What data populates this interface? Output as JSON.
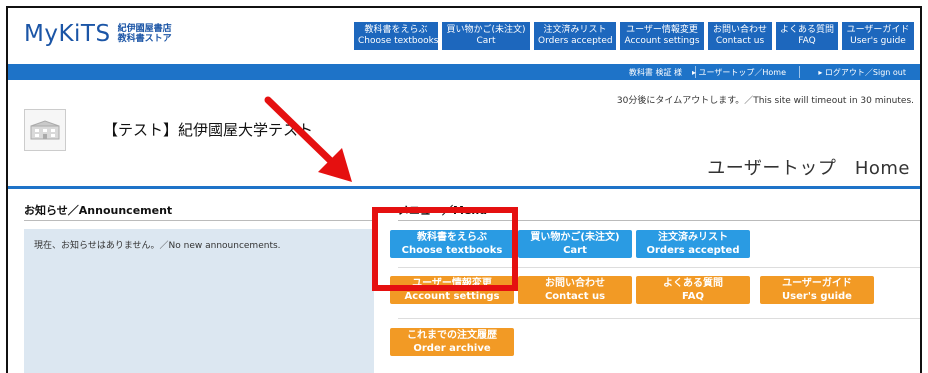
{
  "header": {
    "logo_text": "MyKiTS",
    "logo_sub_1": "紀伊國屋書店",
    "logo_sub_2": "教科書ストア"
  },
  "topnav": [
    {
      "jp": "教科書をえらぶ",
      "en": "Choose textbooks"
    },
    {
      "jp": "買い物かご(未注文)",
      "en": "Cart"
    },
    {
      "jp": "注文済みリスト",
      "en": "Orders accepted"
    },
    {
      "jp": "ユーザー情報変更",
      "en": "Account settings"
    },
    {
      "jp": "お問い合わせ",
      "en": "Contact us"
    },
    {
      "jp": "よくある質問",
      "en": "FAQ"
    },
    {
      "jp": "ユーザーガイド",
      "en": "User's guide"
    }
  ],
  "userbar": {
    "user_name": "教科書 検証 様",
    "home_link": "▸ ユーザートップ／Home",
    "logout_link": "▸ ログアウト／Sign out"
  },
  "timeout_notice": "30分後にタイムアウトします。／This site will timeout in 30 minutes.",
  "school_name": "【テスト】紀伊國屋大学テスト",
  "page_title": "ユーザートップ　Home",
  "announcements": {
    "heading": "お知らせ／Announcement",
    "text": "現在、お知らせはありません。／No new announcements."
  },
  "menu": {
    "heading": "メニュー／Menu",
    "buttons": [
      {
        "jp": "教科書をえらぶ",
        "en": "Choose textbooks",
        "color": "#2a9be3"
      },
      {
        "jp": "買い物かご(未注文)",
        "en": "Cart",
        "color": "#2a9be3"
      },
      {
        "jp": "注文済みリスト",
        "en": "Orders accepted",
        "color": "#2a9be3"
      },
      {
        "jp": "ユーザー情報変更",
        "en": "Account settings",
        "color": "#f29a25"
      },
      {
        "jp": "お問い合わせ",
        "en": "Contact us",
        "color": "#f29a25"
      },
      {
        "jp": "よくある質問",
        "en": "FAQ",
        "color": "#f29a25"
      },
      {
        "jp": "ユーザーガイド",
        "en": "User's guide",
        "color": "#f29a25"
      },
      {
        "jp": "これまでの注文履歴",
        "en": "Order archive",
        "color": "#f29a25"
      }
    ]
  },
  "colors": {
    "brand_blue": "#1b55a6",
    "nav_blue": "#1d67bd",
    "bar_blue": "#1e73c8",
    "annotation_red": "#e51010"
  }
}
